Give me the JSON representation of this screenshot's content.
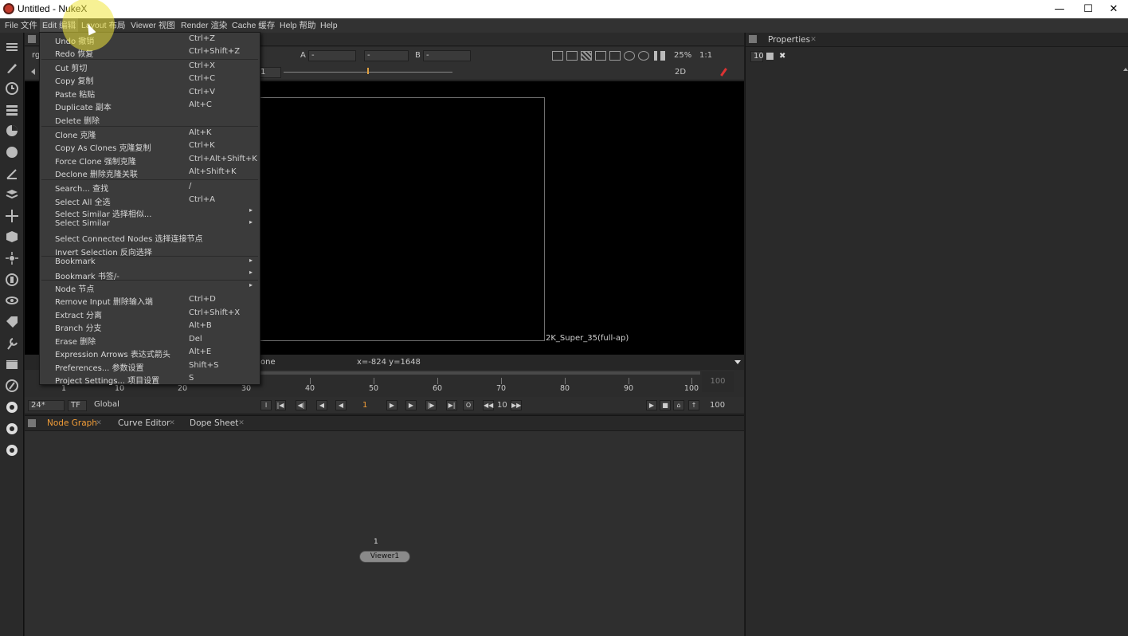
{
  "window": {
    "title": "Untitled - NukeX",
    "minimize": "—",
    "maximize": "☐",
    "close": "✕"
  },
  "menubar": {
    "items": [
      {
        "label": "File 文件"
      },
      {
        "label": "Edit 编辑"
      },
      {
        "label": "Layout 布局"
      },
      {
        "label": "Viewer 视图"
      },
      {
        "label": "Render 渲染"
      },
      {
        "label": "Cache 缓存"
      },
      {
        "label": "Help 帮助"
      },
      {
        "label": "Help"
      }
    ]
  },
  "edit_menu": {
    "items": [
      {
        "label": "Undo 撤销",
        "shortcut": "Ctrl+Z",
        "submenu": false
      },
      {
        "label": "Redo 恢复",
        "shortcut": "Ctrl+Shift+Z",
        "submenu": false
      },
      {
        "label": "Cut 剪切",
        "shortcut": "Ctrl+X",
        "submenu": false
      },
      {
        "label": "Copy 复制",
        "shortcut": "Ctrl+C",
        "submenu": false
      },
      {
        "label": "Paste 粘贴",
        "shortcut": "Ctrl+V",
        "submenu": false
      },
      {
        "label": "Duplicate 副本",
        "shortcut": "Alt+C",
        "submenu": false
      },
      {
        "label": "Delete 删除",
        "shortcut": "",
        "submenu": false
      },
      {
        "label": "Clone 克隆",
        "shortcut": "Alt+K",
        "submenu": false
      },
      {
        "label": "Copy As Clones 克隆复制",
        "shortcut": "Ctrl+K",
        "submenu": false
      },
      {
        "label": "Force Clone 强制克隆",
        "shortcut": "Ctrl+Alt+Shift+K",
        "submenu": false
      },
      {
        "label": "Declone 删除克隆关联",
        "shortcut": "Alt+Shift+K",
        "submenu": false
      },
      {
        "label": "Search... 查找",
        "shortcut": "/",
        "submenu": false
      },
      {
        "label": "Select All 全选",
        "shortcut": "Ctrl+A",
        "submenu": false
      },
      {
        "label": "Select Similar 选择相似...",
        "shortcut": "",
        "submenu": true
      },
      {
        "label": "Select Similar",
        "shortcut": "",
        "submenu": true
      },
      {
        "label": "Select Connected Nodes 选择连接节点",
        "shortcut": "",
        "submenu": false
      },
      {
        "label": "Invert Selection 反向选择",
        "shortcut": "",
        "submenu": false
      },
      {
        "label": "Bookmark",
        "shortcut": "",
        "submenu": true
      },
      {
        "label": "Bookmark 书签/-",
        "shortcut": "",
        "submenu": true
      },
      {
        "label": "Node 节点",
        "shortcut": "",
        "submenu": true
      },
      {
        "label": "Remove Input 删除输入端",
        "shortcut": "Ctrl+D",
        "submenu": false
      },
      {
        "label": "Extract 分离",
        "shortcut": "Ctrl+Shift+X",
        "submenu": false
      },
      {
        "label": "Branch 分支",
        "shortcut": "Alt+B",
        "submenu": false
      },
      {
        "label": "Erase 删除",
        "shortcut": "Del",
        "submenu": false
      },
      {
        "label": "Expression Arrows 表达式箭头",
        "shortcut": "Alt+E",
        "submenu": false
      },
      {
        "label": "Preferences... 参数设置",
        "shortcut": "Shift+S",
        "submenu": false
      },
      {
        "label": "Project Settings... 项目设置",
        "shortcut": "S",
        "submenu": false
      }
    ]
  },
  "viewer": {
    "channel_stub": "rg",
    "input_a_label": "A",
    "input_a_value": "-",
    "input_mid_value": "-",
    "input_b_label": "B",
    "input_b_value": "-",
    "zoom": "25%",
    "ratio": "1:1",
    "frame_field": "1",
    "view_mode": "2D",
    "format_label": "2K_Super_35(full-ap)",
    "info_left": "one",
    "coords": "x=-824 y=1648"
  },
  "timeline": {
    "ticks": [
      "1",
      "10",
      "20",
      "30",
      "40",
      "50",
      "60",
      "70",
      "80",
      "90",
      "100"
    ],
    "end_frame_box": "100",
    "fps": "24*",
    "tf": "TF",
    "global": "Global",
    "current_frame": "1",
    "step": "10",
    "out_frame": "100"
  },
  "node_graph": {
    "tabs": [
      {
        "label": "Node Graph",
        "active": true
      },
      {
        "label": "Curve Editor",
        "active": false
      },
      {
        "label": "Dope Sheet",
        "active": false
      }
    ],
    "viewer_node": "Viewer1",
    "viewer_node_input": "1"
  },
  "properties": {
    "title": "Properties",
    "max_panels": "10"
  },
  "colors": {
    "accent_orange": "#f29d38",
    "menu_bg": "#3b3b3b",
    "panel_bg": "#2f2f2f"
  },
  "icons": {
    "left_toolbar": [
      "toolbar-menu-icon",
      "paint-icon",
      "time-icon",
      "channel-icon",
      "color-icon",
      "filter-icon",
      "draw-icon",
      "merge-icon",
      "transform-icon",
      "3d-icon",
      "particles-icon",
      "deep-icon",
      "views-icon",
      "metadata-icon",
      "toolsets-icon",
      "other-icon",
      "furnace-icon",
      "ocula-icon",
      "plugin-icon-1",
      "plugin-icon-2",
      "plugin-icon-3"
    ]
  }
}
